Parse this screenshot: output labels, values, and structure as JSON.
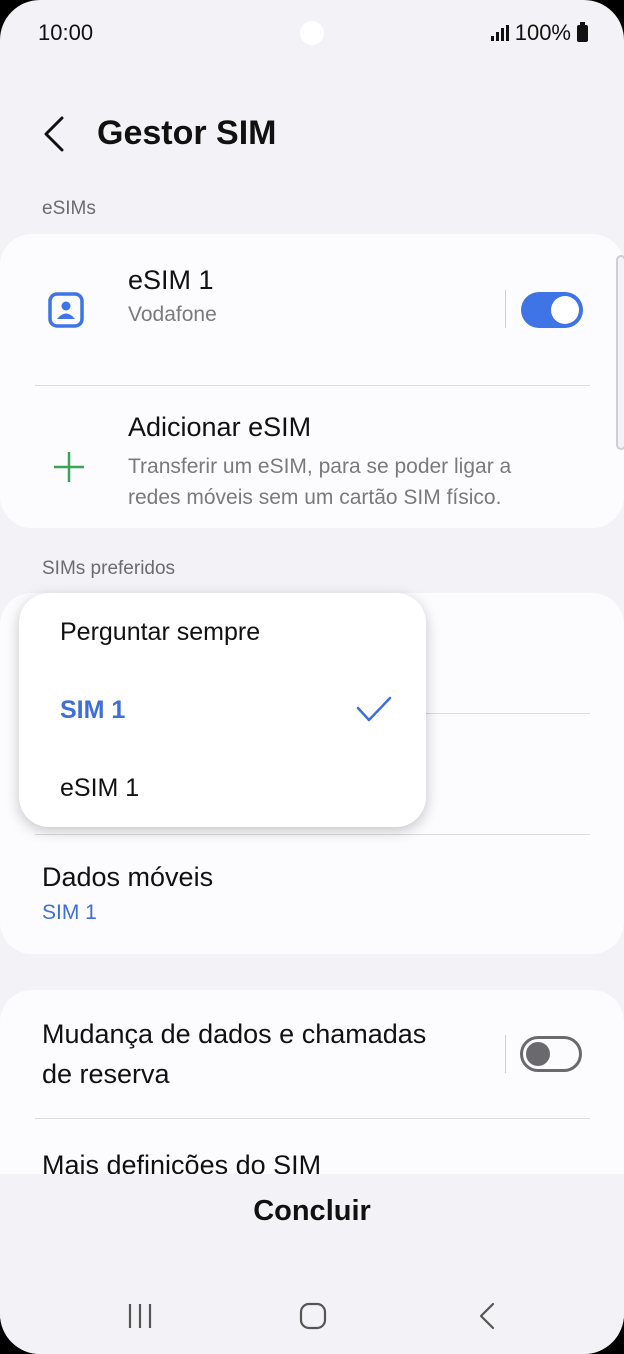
{
  "status_bar": {
    "time": "10:00",
    "battery": "100%"
  },
  "header": {
    "title": "Gestor SIM"
  },
  "esims_section": {
    "label": "eSIMs",
    "esim1": {
      "name": "eSIM 1",
      "carrier": "Vodafone",
      "enabled": true
    },
    "add_esim": {
      "title": "Adicionar eSIM",
      "description_line1": "Transferir um eSIM, para se poder ligar a",
      "description_line2": "redes móveis sem um cartão SIM físico."
    }
  },
  "preferred_section": {
    "label": "SIMs preferidos",
    "mobile_data": {
      "title": "Dados móveis",
      "value": "SIM 1"
    }
  },
  "dropdown": {
    "options": [
      "Perguntar sempre",
      "SIM 1",
      "eSIM 1"
    ],
    "selected": "SIM 1"
  },
  "backup_card": {
    "backup_switch": {
      "line1": "Mudança de dados e chamadas",
      "line2": "de reserva",
      "enabled": false
    },
    "more_settings": "Mais definições do SIM"
  },
  "footer": {
    "done_label": "Concluir"
  },
  "colors": {
    "accent": "#3e74e6",
    "background": "#f3f3f7",
    "card": "#fcfcfe",
    "add_icon": "#3aa35a"
  }
}
